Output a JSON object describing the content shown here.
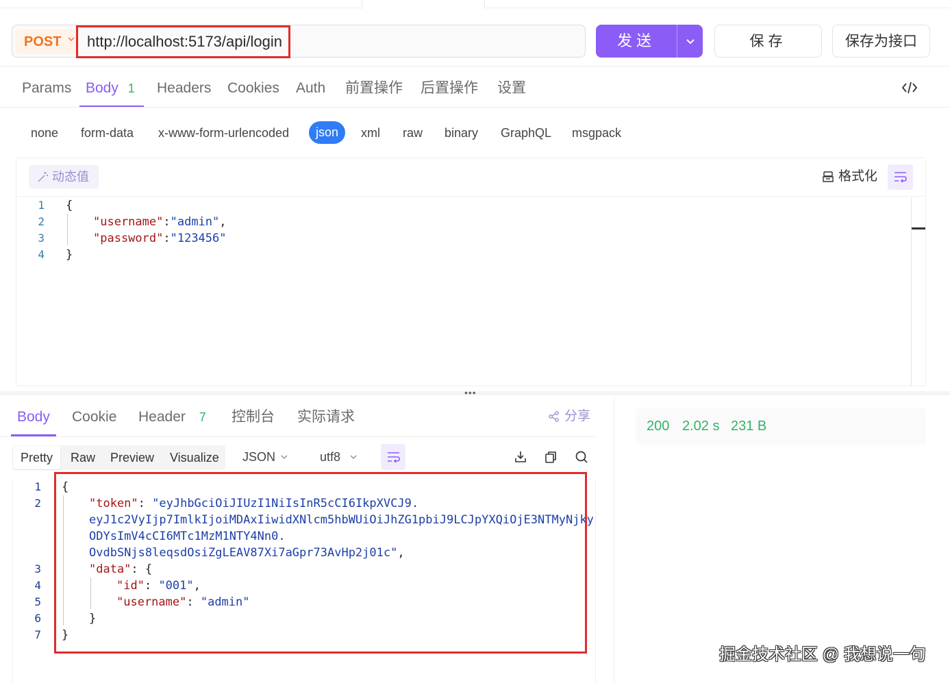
{
  "request": {
    "method": "POST",
    "url": "http://localhost:5173/api/login",
    "send_label": "发送",
    "save_label": "保存",
    "save_as_api_label": "保存为接口"
  },
  "request_tabs": [
    {
      "label": "Params"
    },
    {
      "label": "Body",
      "badge": "1"
    },
    {
      "label": "Headers"
    },
    {
      "label": "Cookies"
    },
    {
      "label": "Auth"
    },
    {
      "label": "前置操作"
    },
    {
      "label": "后置操作"
    },
    {
      "label": "设置"
    }
  ],
  "body_types": [
    "none",
    "form-data",
    "x-www-form-urlencoded",
    "json",
    "xml",
    "raw",
    "binary",
    "GraphQL",
    "msgpack"
  ],
  "body_type_selected": "json",
  "editor": {
    "dynamic_value_label": "动态值",
    "format_label": "格式化",
    "line_numbers": [
      "1",
      "2",
      "3",
      "4"
    ],
    "lines": [
      {
        "open": "{"
      },
      {
        "key": "\"username\"",
        "sep": ":",
        "value": "\"admin\"",
        "tail": ","
      },
      {
        "key": "\"password\"",
        "sep": ":",
        "value": "\"123456\"",
        "tail": ""
      },
      {
        "close": "}"
      }
    ]
  },
  "splitter_handle": "•••",
  "response_tabs": [
    {
      "label": "Body"
    },
    {
      "label": "Cookie"
    },
    {
      "label": "Header",
      "badge": "7"
    },
    {
      "label": "控制台"
    },
    {
      "label": "实际请求"
    }
  ],
  "share_label": "分享",
  "view_tabs": [
    "Pretty",
    "Raw",
    "Preview",
    "Visualize"
  ],
  "format_select": "JSON",
  "encoding_select": "utf8",
  "response_code": {
    "line_numbers": [
      "1",
      "2",
      "",
      "",
      "",
      "3",
      "4",
      "5",
      "6",
      "7"
    ],
    "open": "{",
    "token_key": "\"token\"",
    "token_lines": [
      "\"eyJhbGciOiJIUzI1NiIsInR5cCI6IkpXVCJ9.",
      "eyJ1c2VyIjp7ImlkIjoiMDAxIiwidXNlcm5hbWUiOiJhZG1pbiJ9LCJpYXQiOjE3NTMyNjky",
      "ODYsImV4cCI6MTc1MzM1NTY4Nn0.",
      "OvdbSNjs8leqsdOsiZgLEAV87Xi7aGpr73AvHp2j01c\""
    ],
    "data_key": "\"data\"",
    "id_key": "\"id\"",
    "id_value": "\"001\"",
    "username_key": "\"username\"",
    "username_value": "\"admin\"",
    "inner_close": "}",
    "close": "}"
  },
  "status": {
    "code": "200",
    "time": "2.02 s",
    "size": "231 B",
    "color": "#2fb36a"
  },
  "watermark": "掘金技术社区 @ 我想说一句",
  "colors": {
    "accent": "#8b5cf6",
    "method": "#f0741f",
    "highlight": "#e12b2b",
    "json_active": "#2f7cf6"
  }
}
